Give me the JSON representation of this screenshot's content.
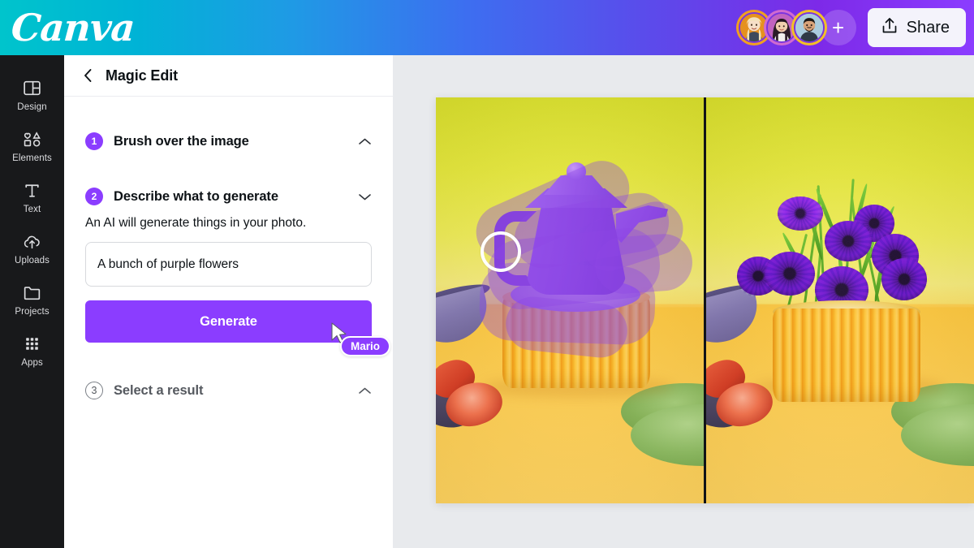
{
  "app": {
    "brand": "Canva"
  },
  "topbar": {
    "logo_text": "Canva",
    "share_label": "Share",
    "add_collaborator_label": "+",
    "collaborators": [
      {
        "name": "collaborator-1",
        "ring": "#f0a020",
        "bg": "#e98b1f"
      },
      {
        "name": "collaborator-2",
        "ring": "#d06ad0",
        "bg": "#c061c0"
      },
      {
        "name": "collaborator-3",
        "ring": "#f2c026",
        "bg": "#a9cbdd"
      }
    ],
    "gradient": [
      "#00c4cc",
      "#3d6ef0",
      "#8b3dff"
    ]
  },
  "rail": {
    "items": [
      {
        "label": "Design",
        "icon": "design-icon"
      },
      {
        "label": "Elements",
        "icon": "elements-icon"
      },
      {
        "label": "Text",
        "icon": "text-icon"
      },
      {
        "label": "Uploads",
        "icon": "uploads-icon"
      },
      {
        "label": "Projects",
        "icon": "projects-icon"
      },
      {
        "label": "Apps",
        "icon": "apps-icon"
      }
    ]
  },
  "panel": {
    "title": "Magic Edit",
    "back_icon": "chevron-left-icon",
    "steps": [
      {
        "number": "1",
        "title": "Brush over the image",
        "state": "active",
        "chevron": "chevron-up-icon"
      },
      {
        "number": "2",
        "title": "Describe what to generate",
        "state": "active",
        "chevron": "chevron-down-icon"
      },
      {
        "number": "3",
        "title": "Select a result",
        "state": "inactive",
        "chevron": "chevron-up-icon"
      }
    ],
    "describe": {
      "help_text": "An AI will generate things in your photo.",
      "input_value": "A bunch of purple flowers",
      "input_placeholder": "Describe what to generate",
      "generate_label": "Generate"
    }
  },
  "cursor": {
    "label": "Mario",
    "color": "#8b3dff"
  },
  "canvas": {
    "left_half_alt": "Purple teapot on orange ribbed pedestal with purple brush mask",
    "right_half_alt": "Purple anemone flowers in orange ribbed vase",
    "brush_tool_active": true
  },
  "colors": {
    "brand_purple": "#8b3dff",
    "rail_bg": "#18191b",
    "workspace_bg": "#e8eaed"
  }
}
